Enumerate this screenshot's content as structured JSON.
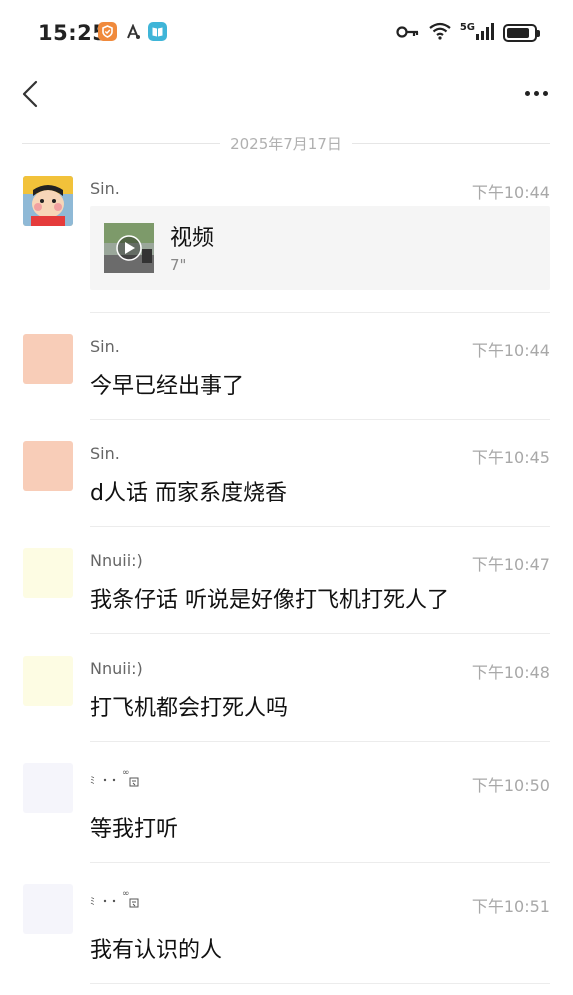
{
  "status_bar": {
    "time": "15:25",
    "network": "5G",
    "battery_level": 0.85,
    "app_icons": [
      "shield-app-icon",
      "translate-app-icon",
      "book-app-icon"
    ]
  },
  "date_separator": "2025年7月17日",
  "messages": [
    {
      "sender": "Sin.",
      "time": "下午10:44",
      "type": "video",
      "video_title": "视频",
      "video_duration": "7\"",
      "avatar": "crayon-shinchan-avatar"
    },
    {
      "sender": "Sin.",
      "time": "下午10:44",
      "type": "text",
      "text": "今早已经出事了",
      "avatar_color": "#f8cdb8"
    },
    {
      "sender": "Sin.",
      "time": "下午10:45",
      "type": "text",
      "text": "d人话 而家系度烧香",
      "avatar_color": "#f8cdb8"
    },
    {
      "sender": "Nnuii:)",
      "time": "下午10:47",
      "type": "text",
      "text": "我条仔话 听说是好像打飞机打死人了",
      "avatar_color": "#fdfce3"
    },
    {
      "sender": "Nnuii:)",
      "time": "下午10:48",
      "type": "text",
      "text": "打飞机都会打死人吗",
      "avatar_color": "#fdfce3"
    },
    {
      "sender": "symbol-name",
      "time": "下午10:50",
      "type": "text",
      "text": "等我打听",
      "avatar_color": "#f5f5fb"
    },
    {
      "sender": "symbol-name",
      "time": "下午10:51",
      "type": "text",
      "text": "我有认识的人",
      "avatar_color": "#f5f5fb"
    }
  ],
  "colors": {
    "divider": "#ececec",
    "time_text": "#a8a8a8",
    "card_bg": "#f5f5f5"
  }
}
